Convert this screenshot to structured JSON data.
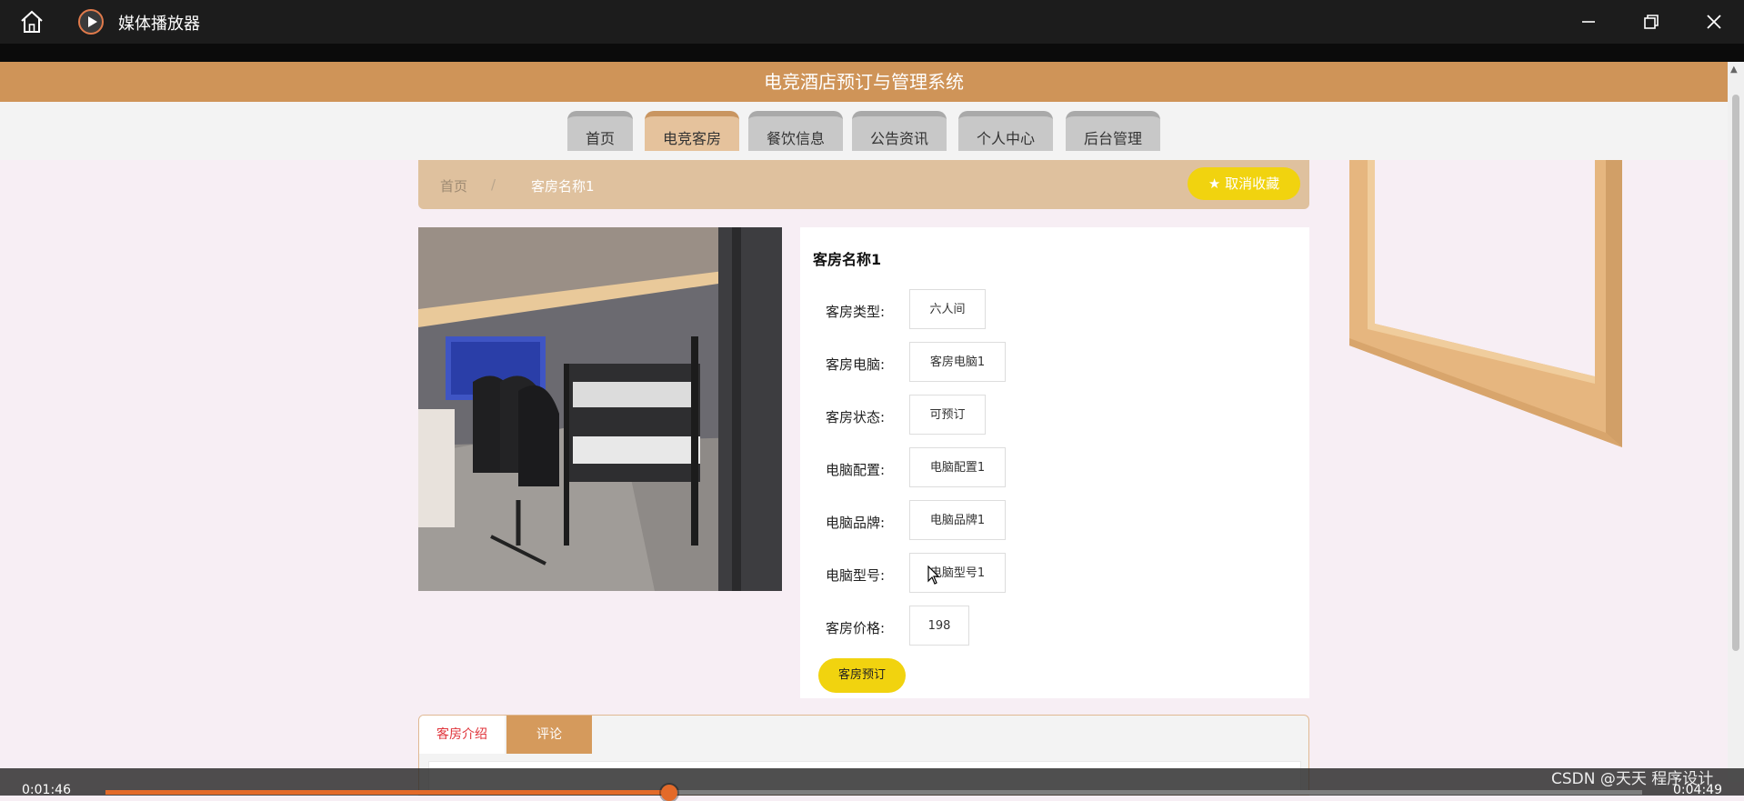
{
  "player": {
    "title": "媒体播放器",
    "current_time": "0:01:46",
    "total_time": "0:04:49",
    "progress": 0.367,
    "watermark": "CSDN @天天 程序设计"
  },
  "site": {
    "title": "电竞酒店预订与管理系统",
    "accent_color": "#cf9458",
    "nav": [
      {
        "label": "首页"
      },
      {
        "label": "电竞客房",
        "active": true
      },
      {
        "label": "餐饮信息"
      },
      {
        "label": "公告资讯"
      },
      {
        "label": "个人中心"
      },
      {
        "label": "后台管理"
      }
    ]
  },
  "breadcrumb": {
    "home": "首页",
    "separator": "/",
    "current": "客房名称1",
    "favorite_label": "取消收藏",
    "favorite_icon": "star-icon"
  },
  "room": {
    "name": "客房名称1",
    "fields": [
      {
        "label": "客房类型:",
        "value": "六人间"
      },
      {
        "label": "客房电脑:",
        "value": "客房电脑1"
      },
      {
        "label": "客房状态:",
        "value": "可预订"
      },
      {
        "label": "电脑配置:",
        "value": "电脑配置1"
      },
      {
        "label": "电脑品牌:",
        "value": "电脑品牌1"
      },
      {
        "label": "电脑型号:",
        "value": "电脑型号1"
      },
      {
        "label": "客房价格:",
        "value": "198"
      }
    ],
    "book_label": "客房预订"
  },
  "tabs": [
    {
      "label": "客房介绍",
      "active": true
    },
    {
      "label": "评论"
    }
  ]
}
